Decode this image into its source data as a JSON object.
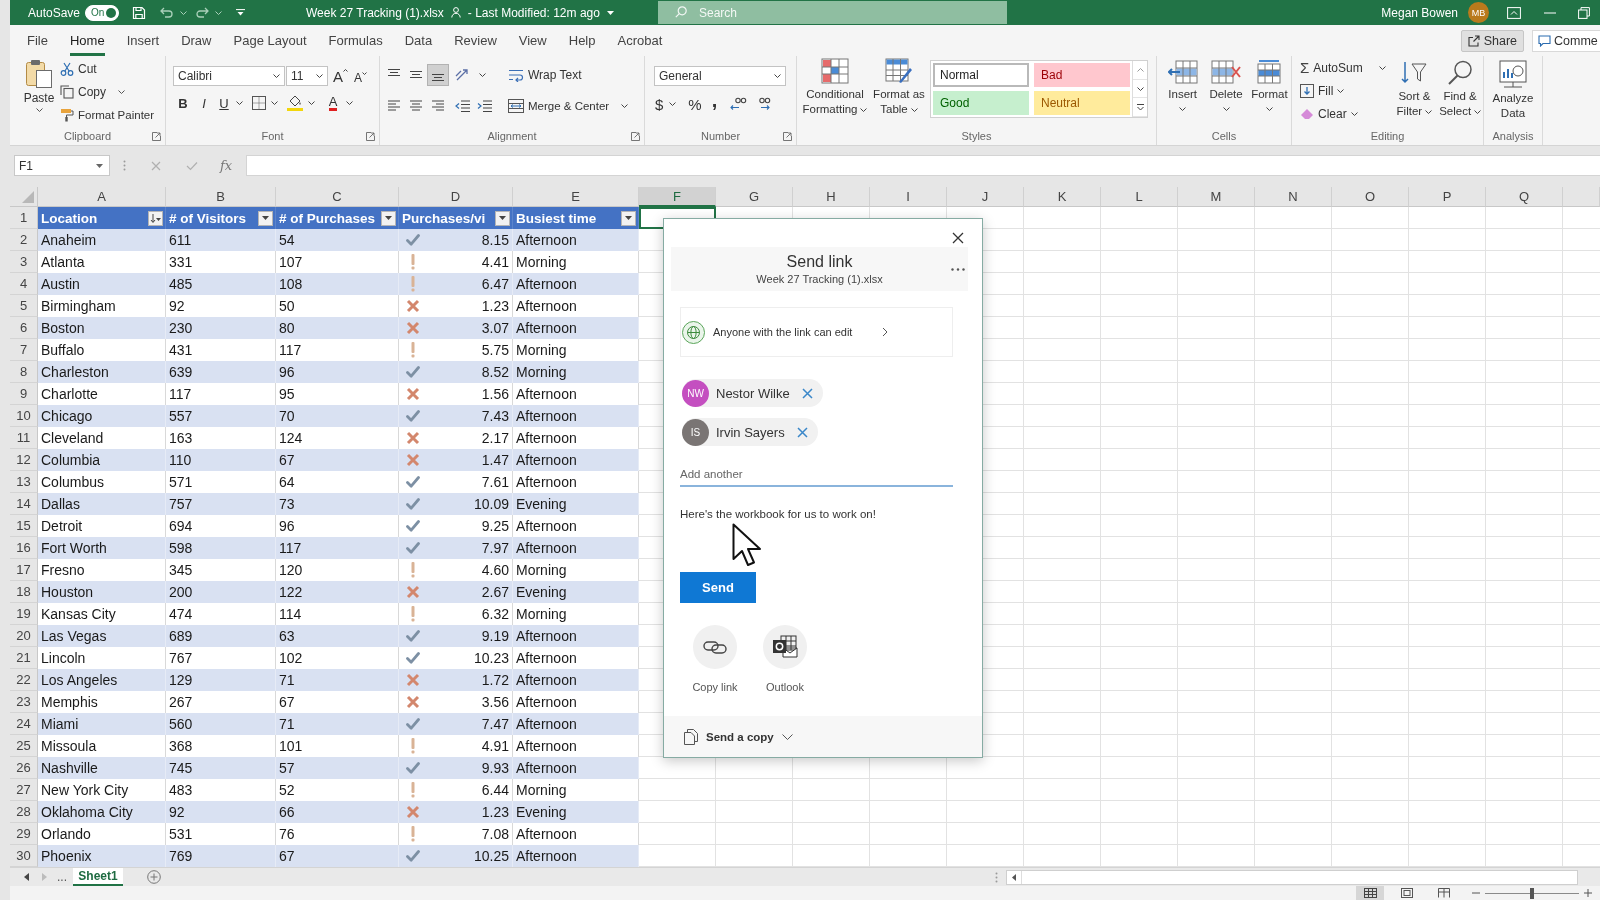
{
  "title_bar": {
    "autosave_label": "AutoSave",
    "autosave_toggle": {
      "label": "On",
      "on": true
    },
    "document_title": "Week 27 Tracking (1).xlsx",
    "modified": "- Last Modified: 12m ago",
    "search": {
      "placeholder": "Search"
    },
    "user_name": "Megan Bowen",
    "user_initials": "MB"
  },
  "menu_tabs": [
    {
      "label": "File",
      "selected": false
    },
    {
      "label": "Home",
      "selected": true
    },
    {
      "label": "Insert",
      "selected": false
    },
    {
      "label": "Draw",
      "selected": false
    },
    {
      "label": "Page Layout",
      "selected": false
    },
    {
      "label": "Formulas",
      "selected": false
    },
    {
      "label": "Data",
      "selected": false
    },
    {
      "label": "Review",
      "selected": false
    },
    {
      "label": "View",
      "selected": false
    },
    {
      "label": "Help",
      "selected": false
    },
    {
      "label": "Acrobat",
      "selected": false
    }
  ],
  "share_button": "Share",
  "comments_button": "Comme",
  "ribbon": {
    "clipboard": {
      "label": "Clipboard",
      "paste": "Paste",
      "cut": "Cut",
      "copy": "Copy",
      "format_painter": "Format Painter"
    },
    "font": {
      "label": "Font",
      "family": "Calibri",
      "size": "11",
      "grow_font": "A",
      "shrink_font": "A",
      "bold": "B",
      "italic": "I",
      "underline": "U",
      "font_color": "A"
    },
    "alignment": {
      "label": "Alignment",
      "vertical_align": [
        {
          "kind": "top",
          "selected": false
        },
        {
          "kind": "middle",
          "selected": false
        },
        {
          "kind": "bottom",
          "selected": true
        }
      ],
      "wrap_text": "Wrap Text",
      "merge_center": "Merge & Center"
    },
    "number": {
      "label": "Number",
      "format": "General",
      "currency": "$",
      "percent": "%",
      "comma": ","
    },
    "styles": {
      "label": "Styles",
      "conditional_formatting": "Conditional Formatting",
      "format_as_table": "Format as Table",
      "cell_styles": [
        {
          "name": "Normal",
          "kind": "normal"
        },
        {
          "name": "Bad",
          "kind": "bad"
        },
        {
          "name": "Good",
          "kind": "good"
        },
        {
          "name": "Neutral",
          "kind": "neutral"
        }
      ]
    },
    "cells": {
      "label": "Cells",
      "insert": "Insert",
      "delete": "Delete",
      "format": "Format"
    },
    "editing": {
      "label": "Editing",
      "autosum_symbol": "Σ",
      "autosum": "AutoSum",
      "fill": "Fill",
      "clear": "Clear",
      "sort_filter": "Sort & Filter",
      "find_select": "Find & Select"
    },
    "analysis": {
      "label": "Analysis",
      "analyze_data": "Analyze Data"
    }
  },
  "formula_bar": {
    "name_box": "F1",
    "function_button": "fx"
  },
  "sheet": {
    "columns": [
      {
        "label": "A",
        "selected": false
      },
      {
        "label": "B",
        "selected": false
      },
      {
        "label": "C",
        "selected": false
      },
      {
        "label": "D",
        "selected": false
      },
      {
        "label": "E",
        "selected": false
      },
      {
        "label": "F",
        "selected": true
      },
      {
        "label": "G",
        "selected": false
      },
      {
        "label": "H",
        "selected": false
      },
      {
        "label": "I",
        "selected": false
      },
      {
        "label": "J",
        "selected": false
      },
      {
        "label": "K",
        "selected": false
      },
      {
        "label": "L",
        "selected": false
      },
      {
        "label": "M",
        "selected": false
      },
      {
        "label": "N",
        "selected": false
      },
      {
        "label": "O",
        "selected": false
      },
      {
        "label": "P",
        "selected": false
      },
      {
        "label": "Q",
        "selected": false
      }
    ],
    "row_numbers": [
      "1",
      "2",
      "3",
      "4",
      "5",
      "6",
      "7",
      "8",
      "9",
      "10",
      "11",
      "12",
      "13",
      "14",
      "15",
      "16",
      "17",
      "18",
      "19",
      "20",
      "21",
      "22",
      "23",
      "24",
      "25",
      "26",
      "27",
      "28",
      "29",
      "30"
    ],
    "table_headers": [
      {
        "label": "Location",
        "sorted": true
      },
      {
        "label": "# of Visitors",
        "sorted": false
      },
      {
        "label": "# of Purchases",
        "sorted": false
      },
      {
        "label": "Purchases/vi",
        "sorted": false
      },
      {
        "label": "Busiest time",
        "sorted": false
      }
    ],
    "rows": [
      {
        "location": "Anaheim",
        "visitors": "611",
        "purchases": "54",
        "kind": "high",
        "ratio": "8.15",
        "busiest_time": "Afternoon"
      },
      {
        "location": "Atlanta",
        "visitors": "331",
        "purchases": "107",
        "kind": "medium",
        "ratio": "4.41",
        "busiest_time": "Morning"
      },
      {
        "location": "Austin",
        "visitors": "485",
        "purchases": "108",
        "kind": "medium",
        "ratio": "6.47",
        "busiest_time": "Afternoon"
      },
      {
        "location": "Birmingham",
        "visitors": "92",
        "purchases": "50",
        "kind": "low",
        "ratio": "1.23",
        "busiest_time": "Afternoon"
      },
      {
        "location": "Boston",
        "visitors": "230",
        "purchases": "80",
        "kind": "low",
        "ratio": "3.07",
        "busiest_time": "Afternoon"
      },
      {
        "location": "Buffalo",
        "visitors": "431",
        "purchases": "117",
        "kind": "medium",
        "ratio": "5.75",
        "busiest_time": "Morning"
      },
      {
        "location": "Charleston",
        "visitors": "639",
        "purchases": "96",
        "kind": "high",
        "ratio": "8.52",
        "busiest_time": "Morning"
      },
      {
        "location": "Charlotte",
        "visitors": "117",
        "purchases": "95",
        "kind": "low",
        "ratio": "1.56",
        "busiest_time": "Afternoon"
      },
      {
        "location": "Chicago",
        "visitors": "557",
        "purchases": "70",
        "kind": "high",
        "ratio": "7.43",
        "busiest_time": "Afternoon"
      },
      {
        "location": "Cleveland",
        "visitors": "163",
        "purchases": "124",
        "kind": "low",
        "ratio": "2.17",
        "busiest_time": "Afternoon"
      },
      {
        "location": "Columbia",
        "visitors": "110",
        "purchases": "67",
        "kind": "low",
        "ratio": "1.47",
        "busiest_time": "Afternoon"
      },
      {
        "location": "Columbus",
        "visitors": "571",
        "purchases": "64",
        "kind": "high",
        "ratio": "7.61",
        "busiest_time": "Afternoon"
      },
      {
        "location": "Dallas",
        "visitors": "757",
        "purchases": "73",
        "kind": "high",
        "ratio": "10.09",
        "busiest_time": "Evening"
      },
      {
        "location": "Detroit",
        "visitors": "694",
        "purchases": "96",
        "kind": "high",
        "ratio": "9.25",
        "busiest_time": "Afternoon"
      },
      {
        "location": "Fort Worth",
        "visitors": "598",
        "purchases": "117",
        "kind": "high",
        "ratio": "7.97",
        "busiest_time": "Afternoon"
      },
      {
        "location": "Fresno",
        "visitors": "345",
        "purchases": "120",
        "kind": "medium",
        "ratio": "4.60",
        "busiest_time": "Morning"
      },
      {
        "location": "Houston",
        "visitors": "200",
        "purchases": "122",
        "kind": "low",
        "ratio": "2.67",
        "busiest_time": "Evening"
      },
      {
        "location": "Kansas City",
        "visitors": "474",
        "purchases": "114",
        "kind": "medium",
        "ratio": "6.32",
        "busiest_time": "Morning"
      },
      {
        "location": "Las Vegas",
        "visitors": "689",
        "purchases": "63",
        "kind": "high",
        "ratio": "9.19",
        "busiest_time": "Afternoon"
      },
      {
        "location": "Lincoln",
        "visitors": "767",
        "purchases": "102",
        "kind": "high",
        "ratio": "10.23",
        "busiest_time": "Afternoon"
      },
      {
        "location": "Los Angeles",
        "visitors": "129",
        "purchases": "71",
        "kind": "low",
        "ratio": "1.72",
        "busiest_time": "Afternoon"
      },
      {
        "location": "Memphis",
        "visitors": "267",
        "purchases": "67",
        "kind": "low",
        "ratio": "3.56",
        "busiest_time": "Afternoon"
      },
      {
        "location": "Miami",
        "visitors": "560",
        "purchases": "71",
        "kind": "high",
        "ratio": "7.47",
        "busiest_time": "Afternoon"
      },
      {
        "location": "Missoula",
        "visitors": "368",
        "purchases": "101",
        "kind": "medium",
        "ratio": "4.91",
        "busiest_time": "Afternoon"
      },
      {
        "location": "Nashville",
        "visitors": "745",
        "purchases": "57",
        "kind": "high",
        "ratio": "9.93",
        "busiest_time": "Afternoon"
      },
      {
        "location": "New York City",
        "visitors": "483",
        "purchases": "52",
        "kind": "medium",
        "ratio": "6.44",
        "busiest_time": "Morning"
      },
      {
        "location": "Oklahoma City",
        "visitors": "92",
        "purchases": "66",
        "kind": "low",
        "ratio": "1.23",
        "busiest_time": "Evening"
      },
      {
        "location": "Orlando",
        "visitors": "531",
        "purchases": "76",
        "kind": "medium",
        "ratio": "7.08",
        "busiest_time": "Afternoon"
      },
      {
        "location": "Phoenix",
        "visitors": "769",
        "purchases": "67",
        "kind": "high",
        "ratio": "10.25",
        "busiest_time": "Afternoon"
      }
    ]
  },
  "sheet_tabs": {
    "overflow": "...",
    "tabs": [
      {
        "label": "Sheet1",
        "selected": true
      }
    ]
  },
  "status_bar": {
    "view_buttons": [
      {
        "kind": "normal",
        "selected": true
      },
      {
        "kind": "page_layout",
        "selected": false
      },
      {
        "kind": "page_break",
        "selected": false
      }
    ],
    "zoom_slider": {
      "level": 0.5
    }
  },
  "share_dialog": {
    "title": "Send link",
    "file_name": "Week 27 Tracking (1).xlsx",
    "link_setting": "Anyone with the link can edit",
    "recipients": [
      {
        "initials": "NW",
        "name": "Nestor Wilke",
        "color": "#c44fc0"
      },
      {
        "initials": "IS",
        "name": "Irvin Sayers",
        "color": "#7a7574"
      }
    ],
    "add_field": {
      "placeholder": "Add another"
    },
    "message": "Here's the workbook for us to work on!",
    "send_button": "Send",
    "share_options": [
      {
        "kind": "copy_link",
        "label": "Copy link"
      },
      {
        "kind": "outlook",
        "label": "Outlook"
      }
    ],
    "send_copy": "Send a copy"
  }
}
